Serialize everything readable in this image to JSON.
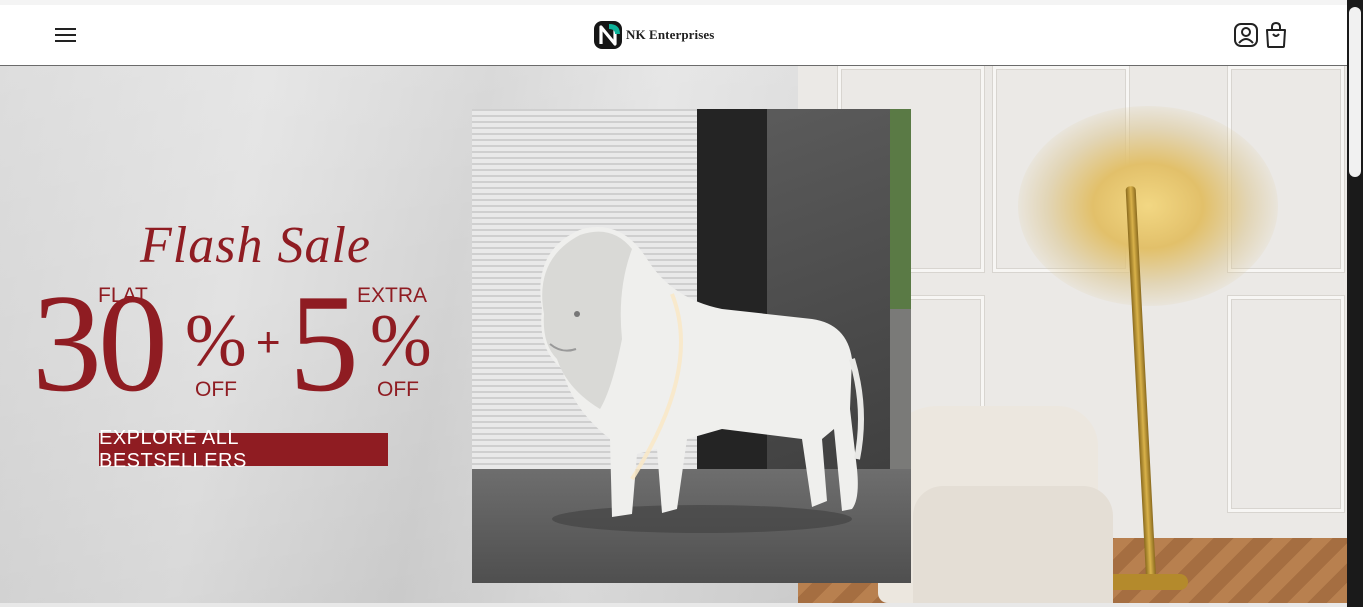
{
  "brand": {
    "name": "NK Enterprises",
    "logo_letter": "N",
    "accent": "#0fb39a"
  },
  "header": {
    "menu_icon": "hamburger-menu-icon",
    "account_icon": "user-account-icon",
    "cart_icon": "shopping-bag-icon"
  },
  "hero": {
    "script_title": "Flash Sale",
    "flat_label": "FLAT",
    "discount_main": "30",
    "percent_sign": "%",
    "off_label": "OFF",
    "plus_sign": "+",
    "extra_label": "EXTRA",
    "discount_extra": "5",
    "cta_label": "EXPLORE ALL BESTSELLERS",
    "accent_color": "#8f1c22"
  }
}
